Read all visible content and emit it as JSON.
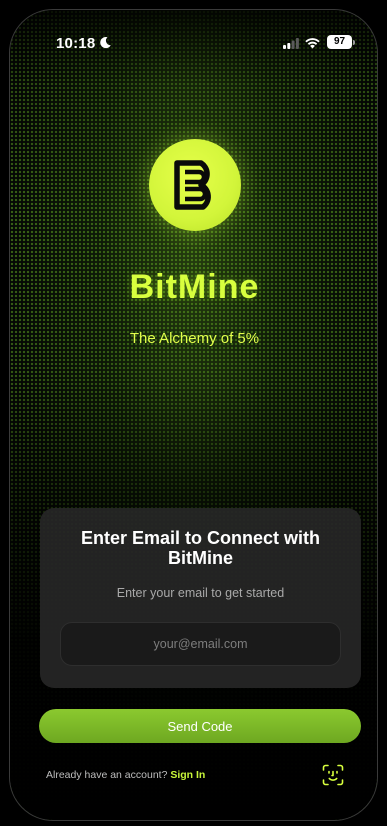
{
  "status_bar": {
    "time": "10:18",
    "battery_level": "97",
    "icons": [
      "moon-icon",
      "signal-icon",
      "wifi-icon",
      "battery-icon"
    ]
  },
  "brand": {
    "logo_letter": "B",
    "name": "BitMine",
    "tagline": "The Alchemy of 5%"
  },
  "email_card": {
    "title": "Enter Email to Connect with BitMine",
    "subtitle": "Enter your email to get started",
    "input": {
      "value": "",
      "placeholder": "your@email.com"
    }
  },
  "actions": {
    "send_code_label": "Send Code"
  },
  "footer": {
    "prompt": "Already have an account?",
    "sign_in_label": "Sign In",
    "biometric_icon": "face-id-icon"
  },
  "colors": {
    "accent": "#d8ff3e",
    "button": "#7bb828",
    "card_bg": "#282828",
    "background": "#000000"
  }
}
